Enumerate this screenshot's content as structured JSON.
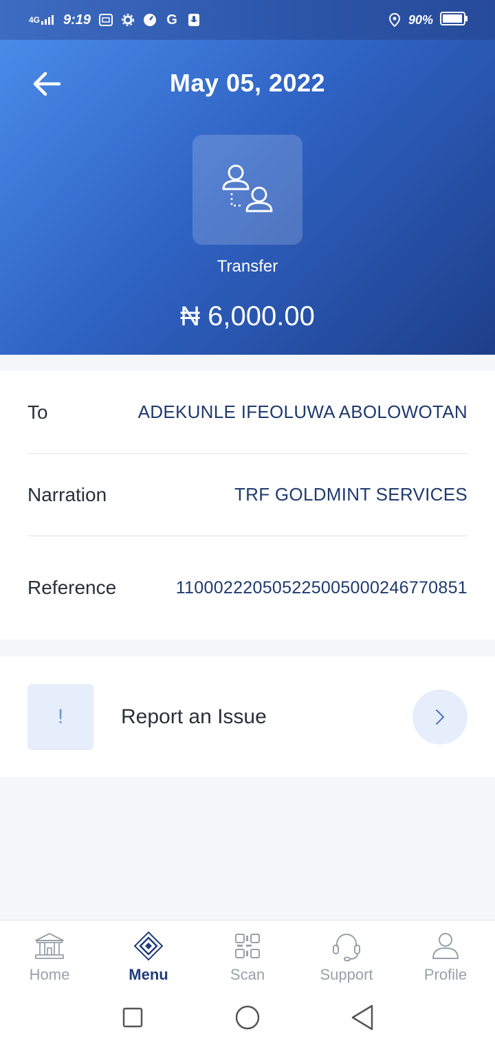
{
  "status_bar": {
    "network": "4G",
    "time": "9:19",
    "battery": "90%"
  },
  "header": {
    "date": "May 05, 2022",
    "transaction_type": "Transfer",
    "amount": "₦ 6,000.00"
  },
  "details": {
    "to": {
      "label": "To",
      "value": "ADEKUNLE IFEOLUWA ABOLOWOTAN"
    },
    "narration": {
      "label": "Narration",
      "value": "TRF GOLDMINT SERVICES"
    },
    "reference": {
      "label": "Reference",
      "value": "110002220505225005000246770851"
    }
  },
  "issue": {
    "icon_text": "!",
    "label": "Report an Issue"
  },
  "bottom_nav": {
    "items": [
      {
        "label": "Home",
        "icon": "bank-icon",
        "active": false
      },
      {
        "label": "Menu",
        "icon": "menu-diamond-icon",
        "active": true
      },
      {
        "label": "Scan",
        "icon": "qr-code-icon",
        "active": false
      },
      {
        "label": "Support",
        "icon": "headset-icon",
        "active": false
      },
      {
        "label": "Profile",
        "icon": "user-icon",
        "active": false
      }
    ]
  },
  "colors": {
    "header_start": "#4a8be8",
    "header_end": "#1e3f8a",
    "value_text": "#1e3a6e",
    "accent_light": "#e6eefb",
    "nav_active": "#1f3c7a"
  }
}
